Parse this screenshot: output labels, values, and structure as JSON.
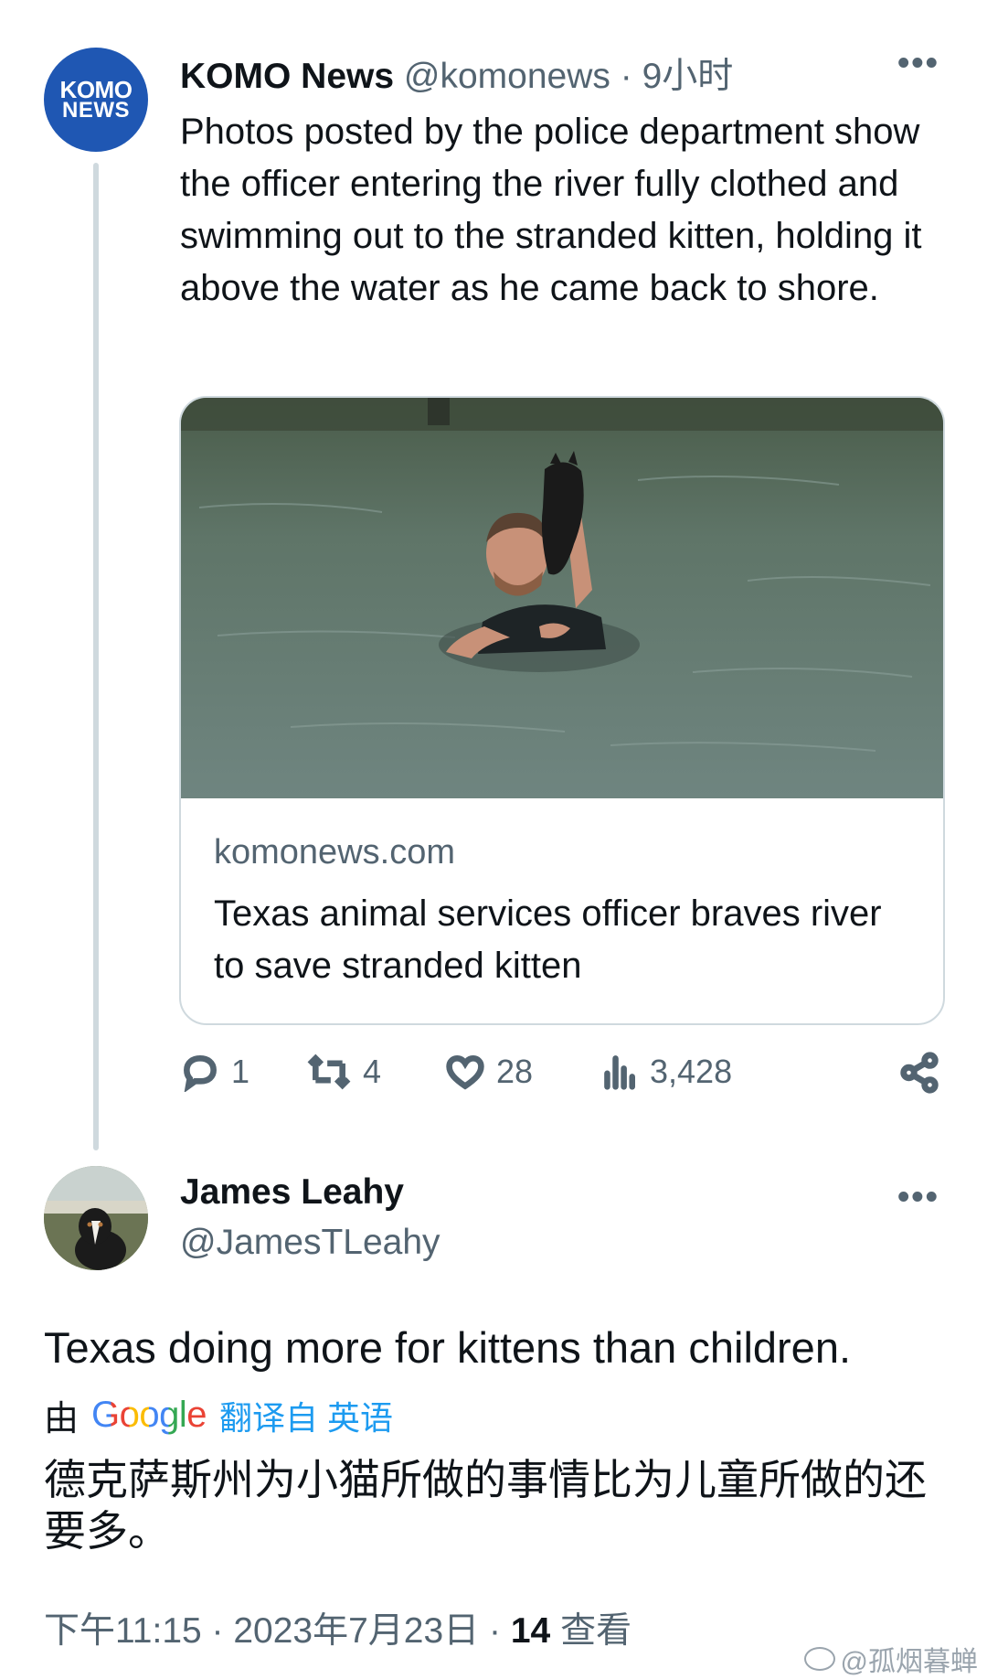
{
  "tweet": {
    "author": {
      "avatar_text_line1": "KOMO",
      "avatar_text_line2": "NEWS",
      "name": "KOMO News",
      "handle": "@komonews",
      "time": "9小时",
      "separator": " · "
    },
    "text": "Photos posted by the police department show the officer entering the river fully clothed and swimming out to the stranded kitten, holding it above the water as he came back to shore.",
    "card": {
      "domain": "komonews.com",
      "title": "Texas animal services officer braves river to save stranded kitten"
    },
    "actions": {
      "replies": "1",
      "retweets": "4",
      "likes": "28",
      "views": "3,428"
    },
    "icons": {
      "more": "more-icon",
      "reply": "reply-icon",
      "retweet": "retweet-icon",
      "like": "heart-icon",
      "views": "views-icon",
      "share": "share-icon"
    }
  },
  "reply": {
    "author": {
      "name": "James Leahy",
      "handle": "@JamesTLeahy"
    },
    "text": "Texas doing more for kittens than children.",
    "translation": {
      "by_label": "由",
      "provider": "Google",
      "from_label": "翻译自 英语",
      "text": "德克萨斯州为小猫所做的事情比为儿童所做的还要多。"
    },
    "footer": {
      "time": "下午11:15 · 2023年7月23日 · ",
      "views_count": "14",
      "views_label": " 查看"
    }
  },
  "watermark": "@孤烟暮蝉",
  "colors": {
    "text": "#0f1419",
    "secondary": "#536471",
    "accent": "#1d9bf0",
    "komo_blue": "#1f57b3",
    "border": "#cfd9de"
  }
}
